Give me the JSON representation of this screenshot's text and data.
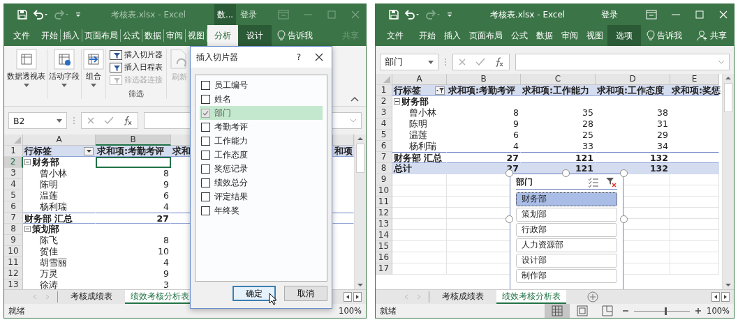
{
  "windows": [
    {
      "active": false,
      "title": "考核表.xlsx  -  Excel",
      "context_label": "数...",
      "sign_in": "登录",
      "tabs": [
        {
          "label": "文件",
          "selected": false,
          "contextual": false
        },
        {
          "label": "开始",
          "selected": false,
          "contextual": false
        },
        {
          "label": "插入",
          "selected": false,
          "contextual": false
        },
        {
          "label": "页面布局",
          "selected": false,
          "contextual": false
        },
        {
          "label": "公式",
          "selected": false,
          "contextual": false
        },
        {
          "label": "数据",
          "selected": false,
          "contextual": false
        },
        {
          "label": "审阅",
          "selected": false,
          "contextual": false
        },
        {
          "label": "视图",
          "selected": false,
          "contextual": false
        },
        {
          "label": "分析",
          "selected": true,
          "contextual": true
        },
        {
          "label": "设计",
          "selected": false,
          "contextual": true
        }
      ],
      "tell_me": "告诉我",
      "share": "共享",
      "ribbon": {
        "large_buttons": [
          {
            "label": "数据透视表"
          },
          {
            "label": "活动字段"
          },
          {
            "label": "组合"
          }
        ],
        "small_buttons": [
          {
            "label": "插入切片器",
            "disabled": false
          },
          {
            "label": "插入日程表",
            "disabled": false
          },
          {
            "label": "筛选器连接",
            "disabled": true
          }
        ],
        "group_label": "筛选",
        "refresh": "刷新"
      },
      "name_box": "B2",
      "row_label_filtered": false,
      "columns": [
        "A",
        "B"
      ],
      "rows": [
        {
          "num": "1",
          "kind": "header",
          "cells": [
            "行标签",
            "求和项:考勤考评",
            "求和",
            null,
            "和项"
          ]
        },
        {
          "num": "2",
          "kind": "group",
          "cell_selected": [
            false,
            true,
            false,
            false,
            false
          ],
          "cells": [
            "财务部",
            null,
            null,
            null,
            null
          ]
        },
        {
          "num": "3",
          "kind": "item",
          "cells": [
            "曾小林",
            "8",
            null,
            null,
            null
          ]
        },
        {
          "num": "4",
          "kind": "item",
          "cells": [
            "陈明",
            "9",
            null,
            null,
            null
          ]
        },
        {
          "num": "5",
          "kind": "item",
          "cells": [
            "温莲",
            "6",
            null,
            null,
            null
          ]
        },
        {
          "num": "6",
          "kind": "item",
          "cells": [
            "杨利瑞",
            "4",
            null,
            null,
            null
          ]
        },
        {
          "num": "7",
          "kind": "subtotal",
          "cells": [
            "财务部 汇总",
            "27",
            null,
            null,
            null
          ]
        },
        {
          "num": "8",
          "kind": "group",
          "cells": [
            "策划部",
            null,
            null,
            null,
            null
          ]
        },
        {
          "num": "9",
          "kind": "item",
          "cells": [
            "陈飞",
            "8",
            null,
            null,
            null
          ]
        },
        {
          "num": "10",
          "kind": "item",
          "cells": [
            "贺佳",
            "10",
            null,
            null,
            null
          ]
        },
        {
          "num": "11",
          "kind": "item",
          "cells": [
            "胡雪丽",
            "4",
            null,
            null,
            null
          ]
        },
        {
          "num": "12",
          "kind": "item",
          "cells": [
            "万灵",
            "9",
            null,
            null,
            null
          ]
        },
        {
          "num": "13",
          "kind": "item",
          "cells": [
            "徐涛",
            "3",
            null,
            null,
            null
          ]
        }
      ],
      "sheet_tabs": [
        {
          "label": "考核成绩表",
          "selected": false
        },
        {
          "label": "绩效考核分析表",
          "selected": true
        }
      ],
      "status": "就绪",
      "zoom": {
        "reading": "100%"
      },
      "dialog": {
        "title": "插入切片器",
        "help": "?",
        "fields": [
          {
            "label": "员工编号",
            "checked": false,
            "disabled": false,
            "selected": false
          },
          {
            "label": "姓名",
            "checked": false,
            "disabled": false,
            "selected": false
          },
          {
            "label": "部门",
            "checked": true,
            "disabled": true,
            "selected": true
          },
          {
            "label": "考勤考评",
            "checked": false,
            "disabled": false,
            "selected": false
          },
          {
            "label": "工作能力",
            "checked": false,
            "disabled": false,
            "selected": false
          },
          {
            "label": "工作态度",
            "checked": false,
            "disabled": false,
            "selected": false
          },
          {
            "label": "奖惩记录",
            "checked": false,
            "disabled": false,
            "selected": false
          },
          {
            "label": "绩效总分",
            "checked": false,
            "disabled": false,
            "selected": false
          },
          {
            "label": "评定结果",
            "checked": false,
            "disabled": false,
            "selected": false
          },
          {
            "label": "年终奖",
            "checked": false,
            "disabled": false,
            "selected": false
          }
        ],
        "buttons": [
          {
            "label": "确定",
            "focused": true
          },
          {
            "label": "取消",
            "focused": false
          }
        ]
      }
    },
    {
      "active": true,
      "title": "考核表.xlsx  -  Excel",
      "sign_in": "登录",
      "tabs": [
        {
          "label": "文件",
          "selected": false,
          "contextual": false
        },
        {
          "label": "开始",
          "selected": false,
          "contextual": false
        },
        {
          "label": "插入",
          "selected": false,
          "contextual": false
        },
        {
          "label": "页面布局",
          "selected": false,
          "contextual": false
        },
        {
          "label": "公式",
          "selected": false,
          "contextual": false
        },
        {
          "label": "数据",
          "selected": false,
          "contextual": false
        },
        {
          "label": "审阅",
          "selected": false,
          "contextual": false
        },
        {
          "label": "视图",
          "selected": false,
          "contextual": false
        },
        {
          "label": "选项",
          "selected": false,
          "contextual": true
        }
      ],
      "tell_me": "告诉我",
      "share": "共享",
      "name_box": "部门",
      "row_label_filtered": true,
      "columns": [
        "A",
        "B",
        "C",
        "D",
        "E"
      ],
      "rows": [
        {
          "num": "1",
          "kind": "header",
          "cells": [
            "行标签",
            "求和项:考勤考评",
            "求和项:工作能力",
            "求和项:工作态度",
            "求和项:奖惩"
          ]
        },
        {
          "num": "2",
          "kind": "group",
          "cells": [
            "财务部",
            null,
            null,
            null,
            null
          ]
        },
        {
          "num": "3",
          "kind": "item",
          "cells": [
            "曾小林",
            "8",
            "35",
            "38",
            null
          ]
        },
        {
          "num": "4",
          "kind": "item",
          "cells": [
            "陈明",
            "9",
            "28",
            "31",
            null
          ]
        },
        {
          "num": "5",
          "kind": "item",
          "cells": [
            "温莲",
            "6",
            "25",
            "29",
            null
          ]
        },
        {
          "num": "6",
          "kind": "item",
          "cells": [
            "杨利瑞",
            "4",
            "33",
            "34",
            null
          ]
        },
        {
          "num": "7",
          "kind": "subtotal",
          "cells": [
            "财务部 汇总",
            "27",
            "121",
            "132",
            null
          ]
        },
        {
          "num": "8",
          "kind": "total",
          "cells": [
            "总计",
            "27",
            "121",
            "132",
            null
          ]
        },
        {
          "num": "9",
          "kind": "empty",
          "cells": [
            null,
            null,
            null,
            null,
            null
          ]
        },
        {
          "num": "10",
          "kind": "empty",
          "cells": [
            null,
            null,
            null,
            null,
            null
          ]
        },
        {
          "num": "11",
          "kind": "empty",
          "cells": [
            null,
            null,
            null,
            null,
            null
          ]
        },
        {
          "num": "12",
          "kind": "empty",
          "cells": [
            null,
            null,
            null,
            null,
            null
          ]
        },
        {
          "num": "13",
          "kind": "empty",
          "cells": [
            null,
            null,
            null,
            null,
            null
          ]
        },
        {
          "num": "14",
          "kind": "empty",
          "cells": [
            null,
            null,
            null,
            null,
            null
          ]
        },
        {
          "num": "15",
          "kind": "empty",
          "cells": [
            null,
            null,
            null,
            null,
            null
          ]
        },
        {
          "num": "16",
          "kind": "empty",
          "cells": [
            null,
            null,
            null,
            null,
            null
          ]
        },
        {
          "num": "17",
          "kind": "empty",
          "cells": [
            null,
            null,
            null,
            null,
            null
          ]
        }
      ],
      "sheet_tabs": [
        {
          "label": "考核成绩表",
          "selected": false
        },
        {
          "label": "绩效考核分析表",
          "selected": true
        }
      ],
      "status": "就绪",
      "zoom": {
        "level": 0.55,
        "reading": "100%"
      },
      "slicer": {
        "title": "部门",
        "items": [
          {
            "label": "财务部",
            "selected": true
          },
          {
            "label": "策划部",
            "selected": false
          },
          {
            "label": "行政部",
            "selected": false
          },
          {
            "label": "人力资源部",
            "selected": false
          },
          {
            "label": "设计部",
            "selected": false
          },
          {
            "label": "制作部",
            "selected": false
          }
        ]
      }
    }
  ]
}
